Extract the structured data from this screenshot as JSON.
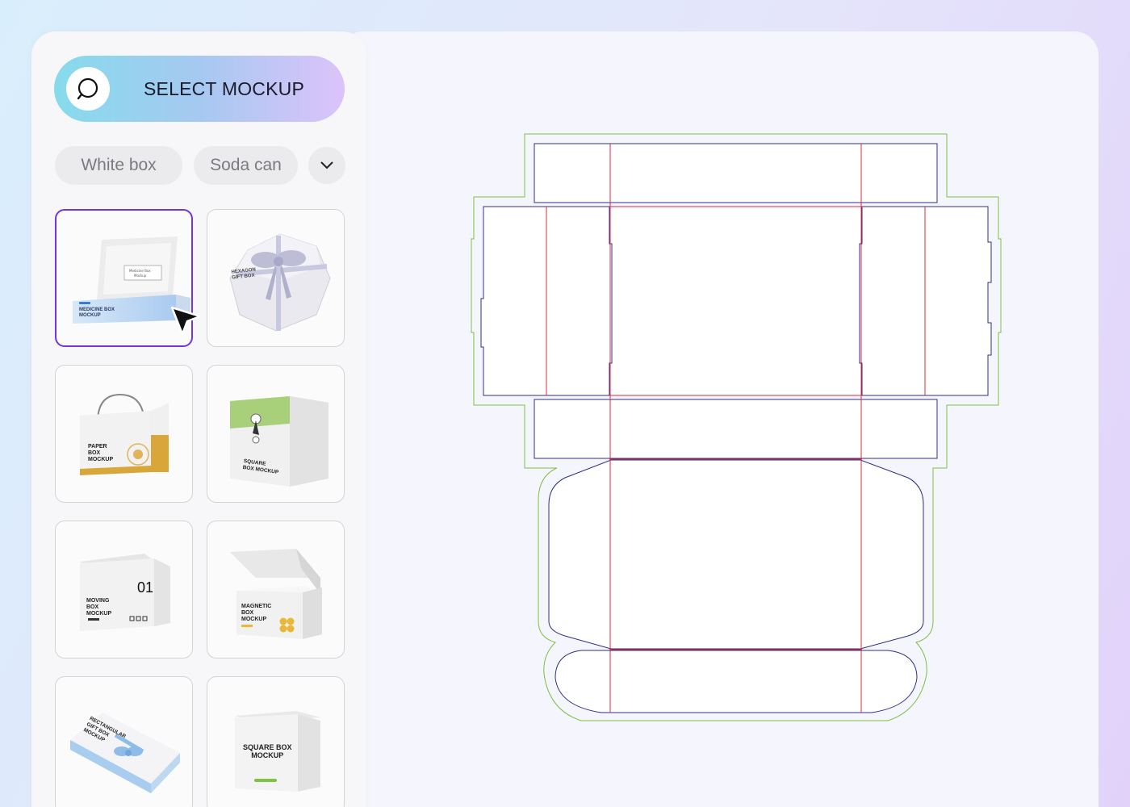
{
  "sidebar": {
    "select_button": {
      "label": "SELECT MOCKUP"
    },
    "filters": [
      "White box",
      "Soda can"
    ],
    "mockups": [
      {
        "label": "MEDICINE BOX\nMOCKUP",
        "inner_text": "Medicine Box\nMockup",
        "selected": true
      },
      {
        "label": "HEXAGON\nGIFT BOX",
        "selected": false
      },
      {
        "label": "PAPER\nBOX\nMOCKUP",
        "selected": false
      },
      {
        "label": "SQUARE\nBOX MOCKUP",
        "selected": false
      },
      {
        "label": "MOVING\nBOX\nMOCKUP",
        "number": "01",
        "selected": false
      },
      {
        "label": "MAGNETIC\nBOX\nMOCKUP",
        "selected": false
      },
      {
        "label": "RECTANGULAR\nGIFT BOX\nMOCKUP",
        "selected": false
      },
      {
        "label": "SQUARE BOX\nMOCKUP",
        "selected": false
      }
    ]
  },
  "colors": {
    "selected_border": "#7135d9",
    "cut_line": "#2f2f8c",
    "fold_line": "#e0283c",
    "bleed_line": "#7fbf3f"
  }
}
